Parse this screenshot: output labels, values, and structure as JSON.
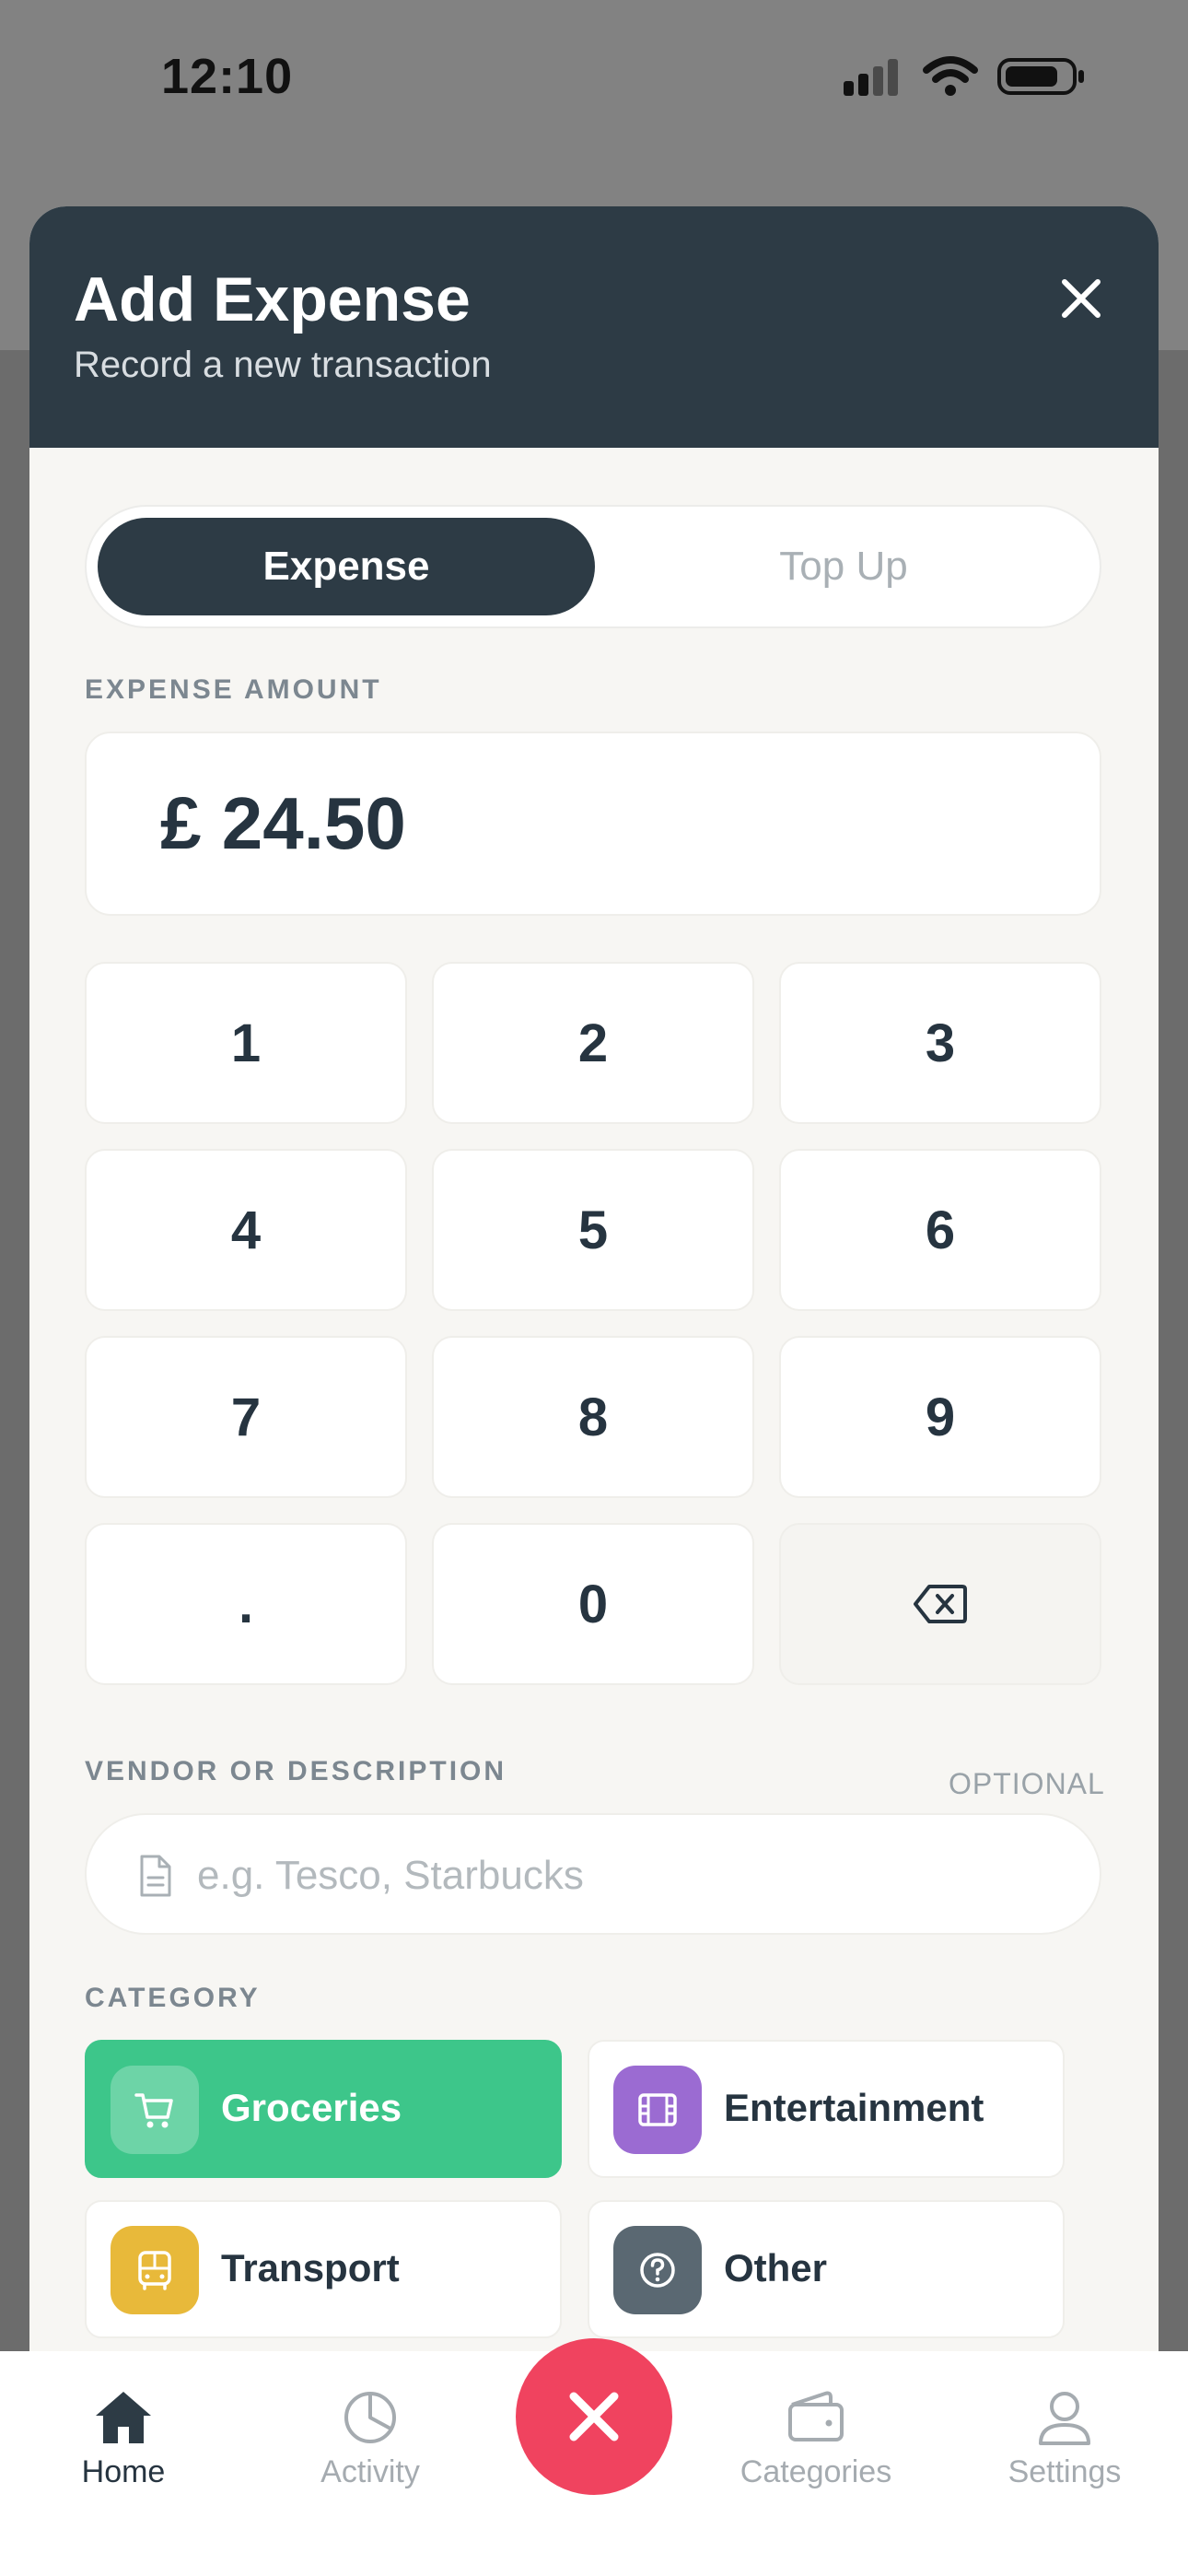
{
  "status_bar": {
    "time": "12:10"
  },
  "header": {
    "title": "Add Expense",
    "subtitle": "Record a new transaction",
    "close_icon": "close-icon"
  },
  "toggle": {
    "options": [
      {
        "label": "Expense",
        "active": true
      },
      {
        "label": "Top Up",
        "active": false
      }
    ]
  },
  "amount": {
    "label": "EXPENSE AMOUNT",
    "value": "£ 24.50"
  },
  "keypad": {
    "keys": [
      "1",
      "2",
      "3",
      "4",
      "5",
      "6",
      "7",
      "8",
      "9",
      ".",
      "0"
    ],
    "backspace_icon": "backspace-icon"
  },
  "description": {
    "label": "VENDOR OR DESCRIPTION",
    "optional": "OPTIONAL",
    "placeholder": "e.g. Tesco, Starbucks",
    "value": "",
    "icon": "document-icon"
  },
  "category": {
    "label": "CATEGORY",
    "items": [
      {
        "label": "Groceries",
        "icon": "cart-icon",
        "color": "#3dc68a",
        "selected": true
      },
      {
        "label": "Entertainment",
        "icon": "film-icon",
        "color": "#9b6bd2",
        "selected": false
      },
      {
        "label": "Transport",
        "icon": "bus-icon",
        "color": "#e8b93a",
        "selected": false
      },
      {
        "label": "Other",
        "icon": "question-icon",
        "color": "#5a6872",
        "selected": false
      }
    ]
  },
  "tabbar": {
    "tabs": [
      {
        "label": "Home",
        "icon": "home-icon",
        "active": true
      },
      {
        "label": "Activity",
        "icon": "pie-chart-icon",
        "active": false
      },
      {
        "label": "Categories",
        "icon": "wallet-icon",
        "active": false
      },
      {
        "label": "Settings",
        "icon": "user-icon",
        "active": false
      }
    ],
    "fab_icon": "close-icon"
  },
  "colors": {
    "header": "#2d3b45",
    "accent_green": "#3dc68a",
    "fab": "#f0435f"
  }
}
